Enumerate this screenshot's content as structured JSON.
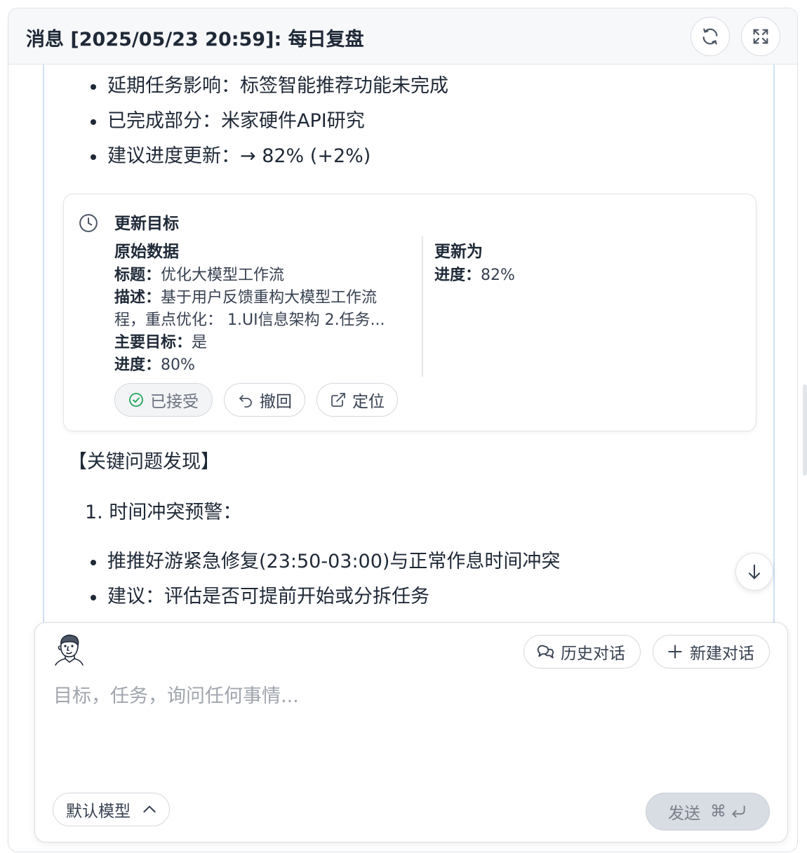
{
  "header": {
    "title": "消息 [2025/05/23 20:59]: 每日复盘",
    "refresh_icon": "refresh-icon",
    "expand_icon": "expand-icon"
  },
  "messages": {
    "bullets_top": [
      "延期任务影响：标签智能推荐功能未完成",
      "已完成部分：米家硬件API研究",
      "建议进度更新：→ 82% (+2%)"
    ],
    "section_heading": "【关键问题发现】",
    "ordered_item": "1. 时间冲突预警：",
    "bullets_bottom": [
      "推推好游紧急修复(23:50-03:00)与正常作息时间冲突",
      "建议：评估是否可提前开始或分拆任务"
    ]
  },
  "update_card": {
    "title": "更新目标",
    "icon": "clock-icon",
    "original": {
      "heading": "原始数据",
      "title_key": "标题：",
      "title_value": "优化大模型工作流",
      "desc_key": "描述：",
      "desc_value_line1": "基于用户反馈重构大模型工作流",
      "desc_value_line2": "程，重点优化： 1.UI信息架构 2.任务...",
      "main_key": "主要目标：",
      "main_value": "是",
      "progress_key": "进度：",
      "progress_value": "80%"
    },
    "updated": {
      "heading": "更新为",
      "progress_key": "进度：",
      "progress_value": "82%"
    },
    "actions": {
      "accepted": "已接受",
      "revert": "撤回",
      "locate": "定位"
    }
  },
  "composer": {
    "history_label": "历史对话",
    "new_chat_label": "新建对话",
    "placeholder": "目标，任务，询问任何事情...",
    "model_label": "默认模型",
    "send_label": "发送",
    "shortcut_symbol": "⌘"
  },
  "colors": {
    "accent_border": "#cfe0f7",
    "accepted_check": "#22a55a",
    "send_bg": "#d8dce3"
  }
}
